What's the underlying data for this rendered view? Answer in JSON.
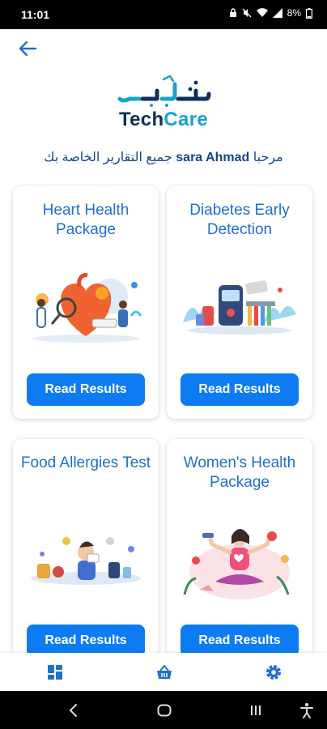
{
  "status": {
    "time": "11:01",
    "battery": "8%"
  },
  "logo": {
    "arabic": "تك كير",
    "en_part1": "Tech",
    "en_part2": "Care"
  },
  "welcome": {
    "prefix": "مرحبا",
    "name": "sara Ahmad",
    "suffix": "جميع التقارير الخاصة بك"
  },
  "cards": [
    {
      "title": "Heart Health Package",
      "button": "Read Results"
    },
    {
      "title": "Diabetes Early Detection",
      "button": "Read Results"
    },
    {
      "title": "Food Allergies Test",
      "button": "Read Results"
    },
    {
      "title": "Women's Health Package",
      "button": "Read Results"
    }
  ],
  "colors": {
    "accent": "#0d7cf2",
    "title": "#1f6fcf",
    "welcome": "#16468b"
  },
  "icons": {
    "back": "arrow-left-icon",
    "nav": [
      "dashboard-icon",
      "basket-icon",
      "gear-icon"
    ]
  }
}
